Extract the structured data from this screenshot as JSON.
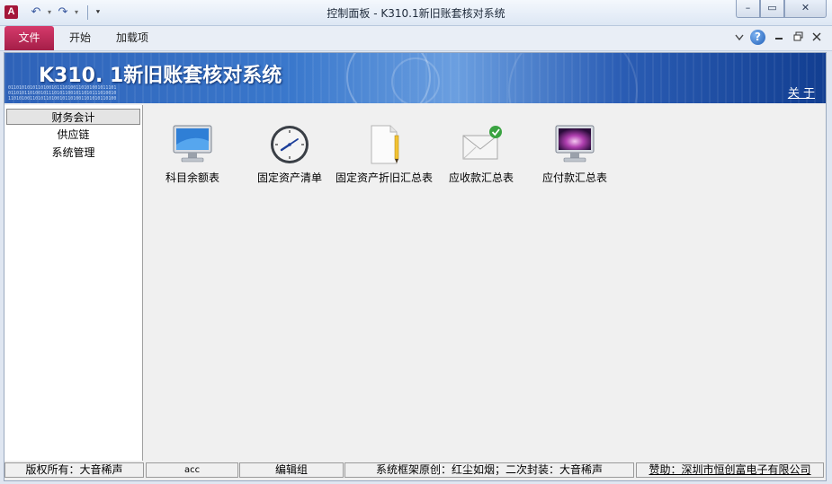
{
  "window": {
    "title": "控制面板  -  K310.1新旧账套核对系统",
    "app_icon": "A",
    "minimize": "–",
    "restore": "▭",
    "close": "✕"
  },
  "quick_access": {
    "undo": "↶",
    "redo": "↷",
    "dropdown": "▾",
    "customize": "⯆"
  },
  "ribbon": {
    "tabs": [
      "文件",
      "开始",
      "加载项"
    ],
    "help": "?"
  },
  "banner": {
    "title": "K310. 1新旧账套核对系统",
    "about": "关 于",
    "digits": "0110101010110100101110100110101001011101 0110101101001011101011001011010111010010 1101010011010110100101101001101010110100"
  },
  "sidebar": {
    "items": [
      "财务会计",
      "供应链",
      "系统管理"
    ]
  },
  "tiles": [
    {
      "label": "科目余额表",
      "icon": "monitor-icon"
    },
    {
      "label": "固定资产清单",
      "icon": "clock-icon"
    },
    {
      "label": "固定资产折旧汇总表",
      "icon": "document-pencil-icon"
    },
    {
      "label": "应收款汇总表",
      "icon": "mail-check-icon"
    },
    {
      "label": "应付款汇总表",
      "icon": "monitor-galaxy-icon"
    }
  ],
  "status": {
    "copyright": "版权所有：大音稀声",
    "user": "acc",
    "group": "编辑组",
    "credit": "系统框架原创：红尘如烟；二次封装：大音稀声",
    "sponsor": "赞助：深圳市恒创富电子有限公司"
  },
  "colors": {
    "file_tab": "#c22a57",
    "banner": "#2e62b8",
    "ribbon": "#e9eef6"
  }
}
